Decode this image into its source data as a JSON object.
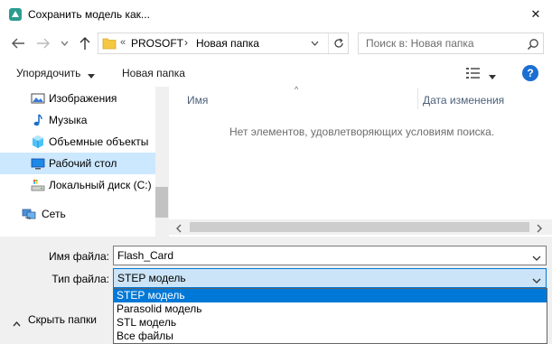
{
  "window": {
    "title": "Сохранить модель как...",
    "close_glyph": "✕"
  },
  "address": {
    "overflow": "«",
    "crumbs": [
      "PROSOFT",
      "Новая папка"
    ],
    "separator": "›"
  },
  "search": {
    "placeholder": "Поиск в: Новая папка"
  },
  "toolbar": {
    "organize_label": "Упорядочить",
    "new_folder_label": "Новая папка",
    "help_label": "?"
  },
  "nav": {
    "items": [
      {
        "label": "Изображения",
        "icon": "pictures-icon"
      },
      {
        "label": "Музыка",
        "icon": "music-icon"
      },
      {
        "label": "Объемные объекты",
        "icon": "3d-objects-icon"
      },
      {
        "label": "Рабочий стол",
        "icon": "desktop-icon",
        "selected": true
      },
      {
        "label": "Локальный диск (C:)",
        "icon": "drive-icon"
      },
      {
        "label": "Сеть",
        "icon": "network-icon"
      }
    ]
  },
  "content": {
    "columns": [
      "Имя",
      "Дата изменения"
    ],
    "empty_message": "Нет элементов, удовлетворяющих условиям поиска."
  },
  "form": {
    "filename_label": "Имя файла:",
    "filename_value": "Flash_Card",
    "filetype_label": "Тип файла:",
    "filetype_value": "STEP модель",
    "filetype_options": [
      "STEP модель",
      "Parasolid модель",
      "STL модель",
      "Все файлы"
    ],
    "filetype_selected_index": 0
  },
  "footer": {
    "hide_folders_label": "Скрыть папки"
  },
  "colors": {
    "accent": "#0078d7",
    "selection": "#cce8ff",
    "help": "#1a6fd1"
  }
}
